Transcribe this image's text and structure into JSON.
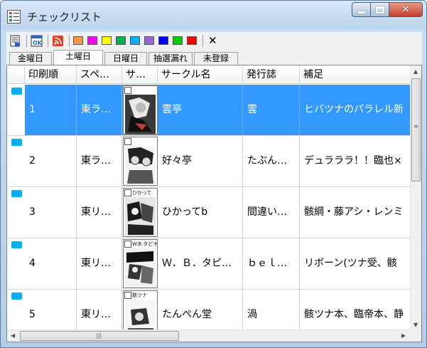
{
  "window": {
    "title": "チェックリスト"
  },
  "toolbar": {
    "swatch_colors": [
      "#f79646",
      "#ff00ff",
      "#ffff00",
      "#00b050",
      "#00b0f0",
      "#9966cc",
      "#0000ff",
      "#00cc00",
      "#ff0000"
    ],
    "close_label": "✕"
  },
  "tabs": [
    {
      "label": "金曜日"
    },
    {
      "label": "土曜日"
    },
    {
      "label": "日曜日"
    },
    {
      "label": "抽選漏れ"
    },
    {
      "label": "未登録"
    }
  ],
  "grid": {
    "columns": [
      "印刷順",
      "スペ…",
      "サ…",
      "サークル名",
      "発行誌",
      "補足"
    ],
    "rows": [
      {
        "order": "1",
        "space": "東ラ…",
        "thumb_caption": "",
        "circle": "雲亭",
        "issue": "雲",
        "note": "ヒバツナのパラレル新",
        "selected": true
      },
      {
        "order": "2",
        "space": "東ラ…",
        "thumb_caption": "",
        "circle": "好々亭",
        "issue": "たぶん…",
        "note": "デュラララ！！臨也×"
      },
      {
        "order": "3",
        "space": "東リ…",
        "thumb_caption": "ひかって",
        "circle": "ひかってb",
        "issue": "間違い…",
        "note": "骸綱・藤アシ・レンミ"
      },
      {
        "order": "4",
        "space": "東リ…",
        "thumb_caption": "W.B.タピオカ",
        "circle": "Ｗ．Ｂ．タピ…",
        "issue": "ｂｅｌ…",
        "note": "リボーン(ツナ受、骸"
      },
      {
        "order": "5",
        "space": "東リ…",
        "thumb_caption": "骸ツナ",
        "circle": "たんぺん堂",
        "issue": "渦",
        "note": "骸ツナ本、臨帝本、静"
      }
    ]
  }
}
